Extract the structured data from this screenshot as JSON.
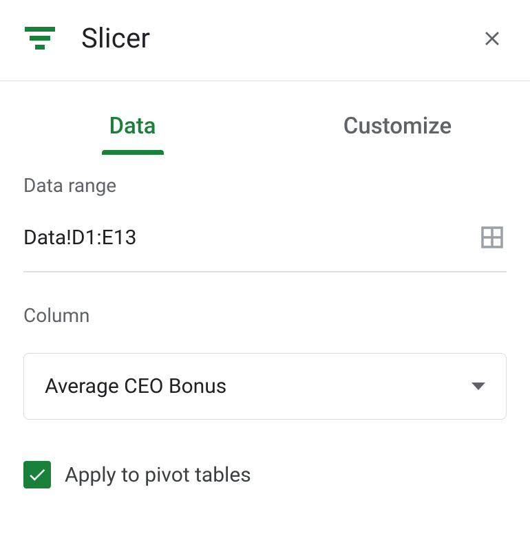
{
  "header": {
    "title": "Slicer"
  },
  "tabs": {
    "data_label": "Data",
    "customize_label": "Customize"
  },
  "data_section": {
    "range_label": "Data range",
    "range_value": "Data!D1:E13",
    "column_label": "Column",
    "column_value": "Average CEO Bonus",
    "apply_label": "Apply to pivot tables",
    "apply_checked": true
  }
}
